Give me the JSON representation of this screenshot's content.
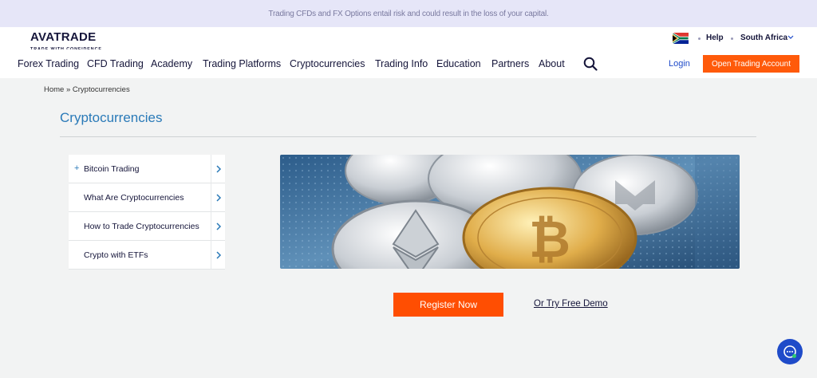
{
  "risk_warning": "Trading CFDs and FX Options entail risk and could result in the loss of your capital.",
  "brand": {
    "name": "AVATRADE",
    "tagline": "TRADE WITH CONFIDENCE",
    "color": "#15153a",
    "accent": "#ff5a0a"
  },
  "topbar": {
    "help_label": "Help",
    "country_label": "South Africa",
    "flag_icon": "south-africa-flag-icon"
  },
  "nav": {
    "items": [
      "Forex Trading",
      "CFD Trading",
      "Academy",
      "Trading Platforms",
      "Cryptocurrencies",
      "Trading Info",
      "Education",
      "Partners",
      "About"
    ],
    "search_icon": "search-icon",
    "login_label": "Login",
    "open_account_label": "Open Trading Account"
  },
  "breadcrumb": "Home » Cryptocurrencies",
  "page_title": "Cryptocurrencies",
  "side_menu": {
    "items": [
      {
        "label": "Bitcoin Trading",
        "expand": "+"
      },
      {
        "label": "What Are Cryptocurrencies"
      },
      {
        "label": "How to Trade Cryptocurrencies"
      },
      {
        "label": "Crypto with ETFs"
      }
    ]
  },
  "cta": {
    "register_label": "Register Now",
    "demo_label": "Or Try Free Demo"
  },
  "chat": {
    "icon": "chat-icon"
  }
}
